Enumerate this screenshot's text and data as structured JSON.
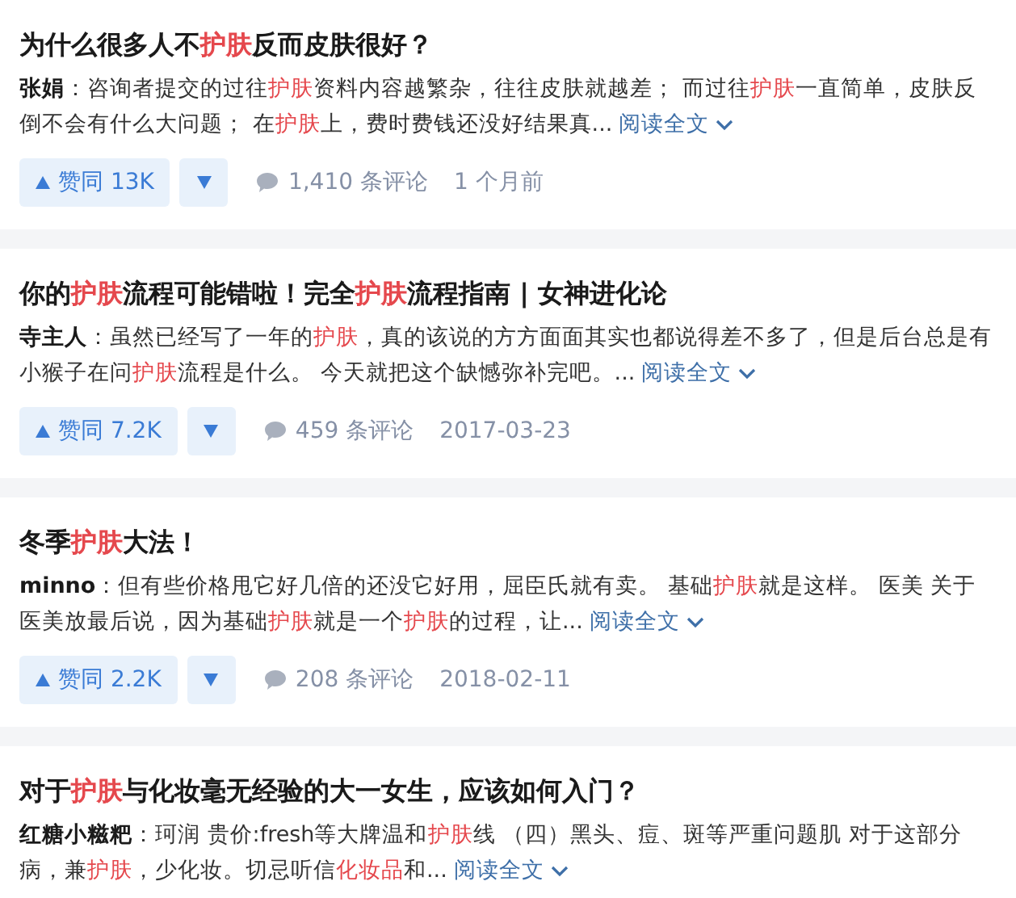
{
  "results": [
    {
      "title": [
        {
          "text": "为什么很多人不",
          "highlight": false
        },
        {
          "text": "护肤",
          "highlight": true
        },
        {
          "text": "反而皮肤很好？",
          "highlight": false
        }
      ],
      "author": "张娟",
      "excerpt": [
        {
          "text": "：咨询者提交的过往",
          "highlight": false
        },
        {
          "text": "护肤",
          "highlight": true
        },
        {
          "text": "资料内容越繁杂，往往皮肤就越差； 而过往",
          "highlight": false
        },
        {
          "text": "护肤",
          "highlight": true
        },
        {
          "text": "一直简单，皮肤反倒不会有什么大问题； 在",
          "highlight": false
        },
        {
          "text": "护肤",
          "highlight": true
        },
        {
          "text": "上，费时费钱还没好结果真...",
          "highlight": false
        }
      ],
      "read_more": "阅读全文",
      "meta": {
        "upvote": "赞同 13K",
        "comments": "1,410 条评论",
        "time": "1 个月前"
      }
    },
    {
      "title": [
        {
          "text": "你的",
          "highlight": false
        },
        {
          "text": "护肤",
          "highlight": true
        },
        {
          "text": "流程可能错啦！完全",
          "highlight": false
        },
        {
          "text": "护肤",
          "highlight": true
        },
        {
          "text": "流程指南 | 女神进化论",
          "highlight": false
        }
      ],
      "author": "寺主人",
      "excerpt": [
        {
          "text": "：虽然已经写了一年的",
          "highlight": false
        },
        {
          "text": "护肤",
          "highlight": true
        },
        {
          "text": "，真的该说的方方面面其实也都说得差不多了，但是后台总是有小猴子在问",
          "highlight": false
        },
        {
          "text": "护肤",
          "highlight": true
        },
        {
          "text": "流程是什么。 今天就把这个缺憾弥补完吧。...",
          "highlight": false
        }
      ],
      "read_more": "阅读全文",
      "meta": {
        "upvote": "赞同 7.2K",
        "comments": "459 条评论",
        "time": "2017-03-23"
      }
    },
    {
      "title": [
        {
          "text": "冬季",
          "highlight": false
        },
        {
          "text": "护肤",
          "highlight": true
        },
        {
          "text": "大法！",
          "highlight": false
        }
      ],
      "author": "minno",
      "excerpt": [
        {
          "text": "：但有些价格甩它好几倍的还没它好用，屈臣氏就有卖。 基础",
          "highlight": false
        },
        {
          "text": "护肤",
          "highlight": true
        },
        {
          "text": "就是这样。 医美 关于医美放最后说，因为基础",
          "highlight": false
        },
        {
          "text": "护肤",
          "highlight": true
        },
        {
          "text": "就是一个",
          "highlight": false
        },
        {
          "text": "护肤",
          "highlight": true
        },
        {
          "text": "的过程，让...",
          "highlight": false
        }
      ],
      "read_more": "阅读全文",
      "meta": {
        "upvote": "赞同 2.2K",
        "comments": "208 条评论",
        "time": "2018-02-11"
      }
    },
    {
      "title": [
        {
          "text": "对于",
          "highlight": false
        },
        {
          "text": "护肤",
          "highlight": true
        },
        {
          "text": "与化妆毫无经验的大一女生，应该如何入门？",
          "highlight": false
        }
      ],
      "author": "红糖小糍粑",
      "excerpt": [
        {
          "text": "：珂润 贵价:fresh等大牌温和",
          "highlight": false
        },
        {
          "text": "护肤",
          "highlight": true
        },
        {
          "text": "线 （四）黑头、痘、斑等严重问题肌 对于这部分",
          "highlight": false
        },
        {
          "text": "病，兼",
          "highlight": false
        },
        {
          "text": "护肤",
          "highlight": true
        },
        {
          "text": "，少化妆。切忌听信",
          "highlight": false
        },
        {
          "text": "化妆品",
          "highlight": true
        },
        {
          "text": "和...",
          "highlight": false
        }
      ],
      "read_more": "阅读全文"
    }
  ]
}
